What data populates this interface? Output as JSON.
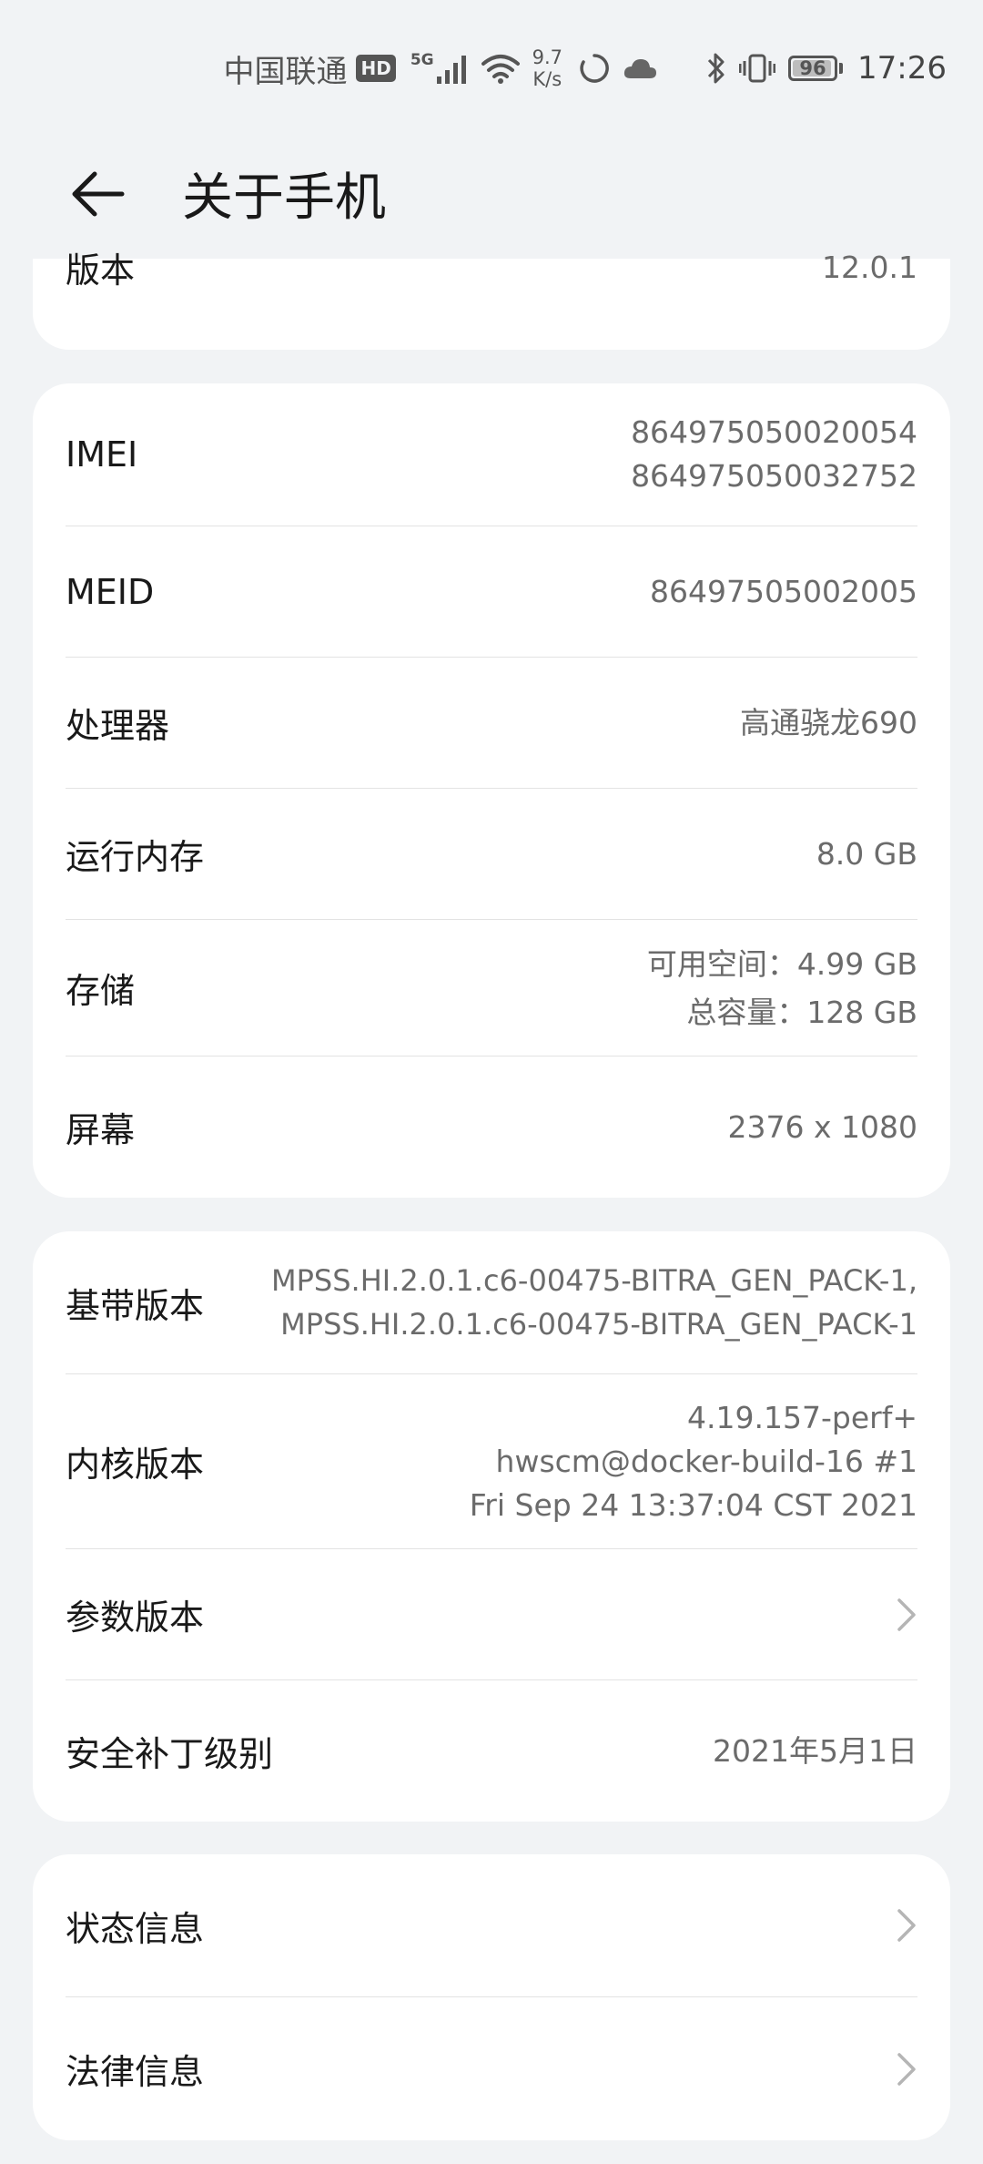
{
  "status_bar": {
    "carrier": "中国联通",
    "hd": "HD",
    "network": "5G",
    "speed_value": "9.7",
    "speed_unit": "K/s",
    "battery": "96",
    "battery_level": 0.96,
    "time": "17:26"
  },
  "header": {
    "title": "关于手机",
    "back_icon": "arrow-left-icon"
  },
  "card_version": {
    "label": "版本",
    "value": "12.0.1"
  },
  "card_device": {
    "imei": {
      "label": "IMEI",
      "values": [
        "864975050020054",
        "864975050032752"
      ]
    },
    "meid": {
      "label": "MEID",
      "value": "86497505002005"
    },
    "processor": {
      "label": "处理器",
      "value": "高通骁龙690"
    },
    "ram": {
      "label": "运行内存",
      "value": "8.0 GB"
    },
    "storage": {
      "label": "存储",
      "available": "可用空间：4.99  GB",
      "total": "总容量：128  GB"
    },
    "screen": {
      "label": "屏幕",
      "value": "2376 x 1080"
    }
  },
  "card_software": {
    "baseband": {
      "label": "基带版本",
      "values": [
        "MPSS.HI.2.0.1.c6-00475-BITRA_GEN_PACK-1,",
        "MPSS.HI.2.0.1.c6-00475-BITRA_GEN_PACK-1"
      ]
    },
    "kernel": {
      "label": "内核版本",
      "values": [
        "4.19.157-perf+",
        "hwscm@docker-build-16 #1",
        "Fri Sep 24 13:37:04 CST 2021"
      ]
    },
    "params": {
      "label": "参数版本",
      "icon": "chevron-right-icon"
    },
    "security_patch": {
      "label": "安全补丁级别",
      "value": "2021年5月1日"
    }
  },
  "card_info": {
    "status": {
      "label": "状态信息",
      "icon": "chevron-right-icon"
    },
    "legal": {
      "label": "法律信息",
      "icon": "chevron-right-icon"
    }
  },
  "colors": {
    "background": "#f1f3f5",
    "card": "#ffffff",
    "primary_text": "#191919",
    "secondary_text": "#6b6b6b",
    "divider": "#e3e3e3"
  }
}
